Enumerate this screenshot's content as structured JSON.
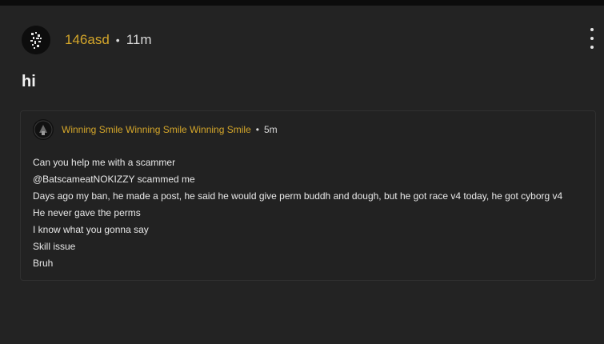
{
  "post": {
    "author": "146asd",
    "separator": "•",
    "time": "11m",
    "title": "hi"
  },
  "quoted_post": {
    "author": "Winning Smile Winning Smile Winning Smile",
    "separator": "•",
    "time": "5m",
    "lines": [
      "Can you help me with a scammer",
      "@BatscameatNOKIZZY scammed me",
      "Days ago my ban, he made a post, he said he would give perm buddh and dough, but he got race v4 today, he got cyborg v4",
      "He never gave the perms",
      "I know what you gonna say",
      "Skill issue",
      "Bruh"
    ]
  },
  "colors": {
    "username": "#d4a62a",
    "background": "#232323",
    "text": "#e8e8e8"
  },
  "icons": {
    "menu": "more-vertical-icon",
    "avatar": "avatar-image",
    "quoted_avatar": "avatar-image"
  }
}
